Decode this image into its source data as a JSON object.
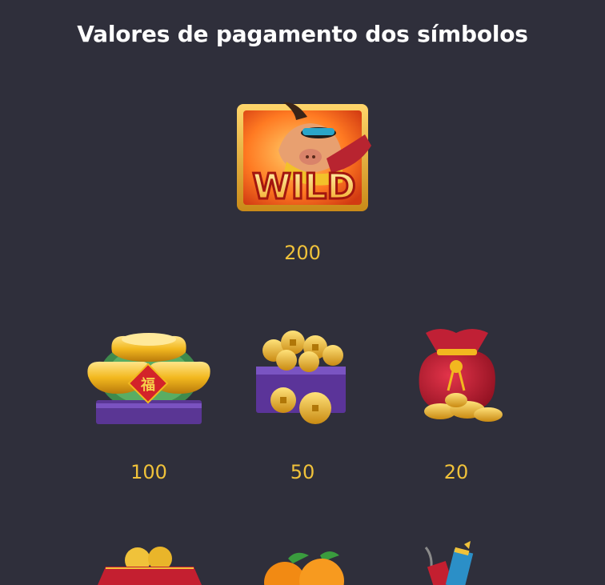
{
  "page": {
    "title": "Valores de pagamento dos símbolos"
  },
  "wild": {
    "label": "WILD",
    "value": "200",
    "icon": "wild-ox-icon"
  },
  "symbols": [
    {
      "icon": "gold-ingot-icon",
      "value": "100"
    },
    {
      "icon": "coin-chest-icon",
      "value": "50"
    },
    {
      "icon": "money-bag-icon",
      "value": "20"
    }
  ],
  "partial_symbols": [
    {
      "icon": "red-envelope-coins-icon"
    },
    {
      "icon": "oranges-icon"
    },
    {
      "icon": "firecracker-icon"
    }
  ],
  "colors": {
    "background": "#2f2f3b",
    "value_text": "#f0c23a",
    "title_text": "#ffffff"
  }
}
